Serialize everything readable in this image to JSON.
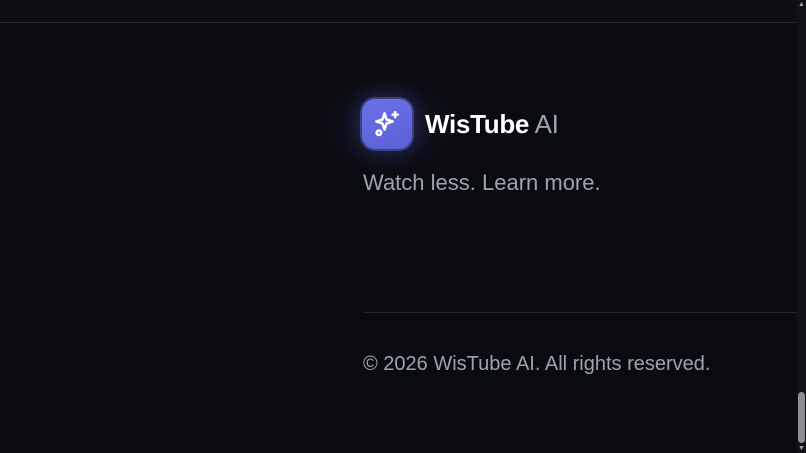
{
  "brand": {
    "name_main": "WisTube",
    "name_suffix": " AI",
    "logo_icon": "sparkles-icon",
    "accent_color": "#6366f1"
  },
  "tagline": "Watch less. Learn more.",
  "footer": {
    "copyright": "© 2026 WisTube AI. All rights reserved."
  },
  "colors": {
    "background": "#0a0b10",
    "text_primary": "#ffffff",
    "text_muted": "#9ca3af",
    "divider": "#23252d"
  },
  "scrollbar": {
    "up_icon": "arrow-up-icon",
    "down_icon": "arrow-down-icon",
    "position_fraction": 0.97
  }
}
